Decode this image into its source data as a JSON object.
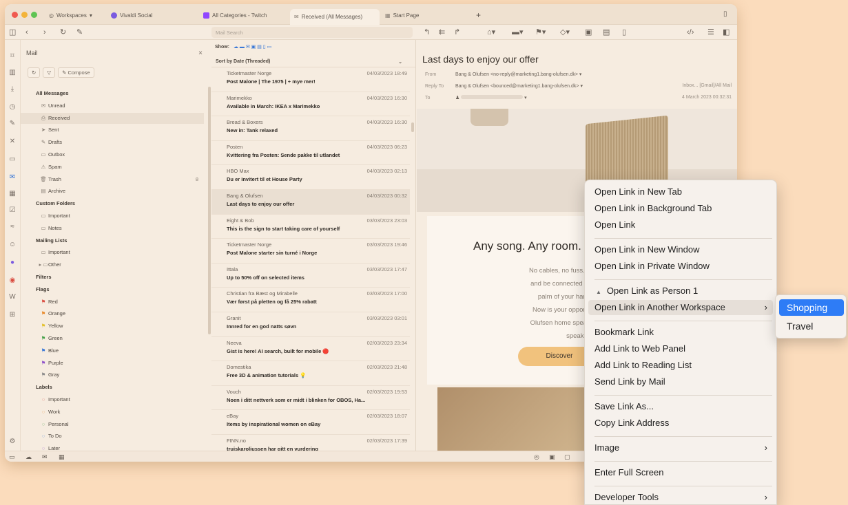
{
  "tabs": {
    "workspaces": "Workspaces",
    "items": [
      {
        "label": "Vivaldi Social",
        "color": "#7b5be0"
      },
      {
        "label": "All Categories - Twitch",
        "color": "#9146ff"
      },
      {
        "label": "Received (All Messages)",
        "color": "#8a8076"
      },
      {
        "label": "Start Page",
        "color": "#8a8076"
      }
    ],
    "new_tab": "+"
  },
  "search": {
    "placeholder": "Mail Search"
  },
  "mail": {
    "title": "Mail",
    "close": "×",
    "compose": "Compose",
    "folders": [
      {
        "label": "All Messages",
        "type": "head"
      },
      {
        "label": "Unread",
        "icon": "✉",
        "type": "item"
      },
      {
        "label": "Received",
        "icon": "⎙",
        "type": "item",
        "selected": true
      },
      {
        "label": "Sent",
        "icon": "➤",
        "type": "item"
      },
      {
        "label": "Drafts",
        "icon": "✎",
        "type": "item"
      },
      {
        "label": "Outbox",
        "icon": "▭",
        "type": "item"
      },
      {
        "label": "Spam",
        "icon": "⚠",
        "type": "item"
      },
      {
        "label": "Trash",
        "icon": "🗑",
        "type": "item",
        "count": "8"
      },
      {
        "label": "Archive",
        "icon": "▤",
        "type": "item"
      },
      {
        "label": "Custom Folders",
        "type": "head"
      },
      {
        "label": "Important",
        "icon": "▭",
        "type": "item"
      },
      {
        "label": "Notes",
        "icon": "▭",
        "type": "item"
      },
      {
        "label": "Mailing Lists",
        "type": "head"
      },
      {
        "label": "Important",
        "icon": "▭",
        "type": "item"
      },
      {
        "label": "Other",
        "icon": "▸ ▭",
        "type": "item"
      },
      {
        "label": "Filters",
        "type": "head"
      },
      {
        "label": "Flags",
        "type": "head"
      },
      {
        "label": "Red",
        "icon": "⚑",
        "color": "#d94b3f",
        "type": "item"
      },
      {
        "label": "Orange",
        "icon": "⚑",
        "color": "#e98a2b",
        "type": "item"
      },
      {
        "label": "Yellow",
        "icon": "⚑",
        "color": "#e3c02a",
        "type": "item"
      },
      {
        "label": "Green",
        "icon": "⚑",
        "color": "#45a049",
        "type": "item"
      },
      {
        "label": "Blue",
        "icon": "⚑",
        "color": "#3a78d6",
        "type": "item"
      },
      {
        "label": "Purple",
        "icon": "⚑",
        "color": "#8d4fc9",
        "type": "item"
      },
      {
        "label": "Gray",
        "icon": "⚑",
        "color": "#8a8a8a",
        "type": "item"
      },
      {
        "label": "Labels",
        "type": "head"
      },
      {
        "label": "Important",
        "icon": "◌",
        "color": "#d94b3f",
        "type": "item"
      },
      {
        "label": "Work",
        "icon": "◌",
        "color": "#e98a2b",
        "type": "item"
      },
      {
        "label": "Personal",
        "icon": "◌",
        "color": "#45a049",
        "type": "item"
      },
      {
        "label": "To Do",
        "icon": "◌",
        "color": "#3a78d6",
        "type": "item"
      },
      {
        "label": "Later",
        "icon": "◌",
        "color": "#8d4fc9",
        "type": "item"
      }
    ]
  },
  "list": {
    "show_label": "Show:",
    "sort_label": "Sort by Date (Threaded)",
    "messages": [
      {
        "from": "Ticketmaster Norge",
        "date": "04/03/2023 18:49",
        "subject": "Post Malone | The 1975 | + mye mer!"
      },
      {
        "from": "Marimekko",
        "date": "04/03/2023 16:30",
        "subject": "Available in March: IKEA x Marimekko"
      },
      {
        "from": "Bread & Boxers",
        "date": "04/03/2023 16:30",
        "subject": "New in: Tank relaxed"
      },
      {
        "from": "Posten",
        "date": "04/03/2023 06:23",
        "subject": "Kvittering fra Posten: Sende pakke til utlandet"
      },
      {
        "from": "HBO Max",
        "date": "04/03/2023 02:13",
        "subject": "Du er invitert til et House Party"
      },
      {
        "from": "Bang & Olufsen",
        "date": "04/03/2023 00:32",
        "subject": "Last days to enjoy our offer",
        "selected": true
      },
      {
        "from": "Eight & Bob",
        "date": "03/03/2023 23:03",
        "subject": "This is the sign to start taking care of yourself"
      },
      {
        "from": "Ticketmaster Norge",
        "date": "03/03/2023 19:46",
        "subject": "Post Malone starter sin turné i Norge"
      },
      {
        "from": "Ittala",
        "date": "03/03/2023 17:47",
        "subject": "Up to 50% off on selected items"
      },
      {
        "from": "Christian fra Bæst og Mirabelle",
        "date": "03/03/2023 17:00",
        "subject": "Vær først på pletten og få 25% rabatt"
      },
      {
        "from": "Granit",
        "date": "03/03/2023 03:01",
        "subject": "Innred for en god natts søvn"
      },
      {
        "from": "Neeva",
        "date": "02/03/2023 23:34",
        "subject": "Gist is here! AI search, built for mobile 🔴"
      },
      {
        "from": "Domestika",
        "date": "02/03/2023 21:48",
        "subject": "Free 3D & animation tutorials 💡"
      },
      {
        "from": "Vouch",
        "date": "02/03/2023 19:53",
        "subject": "Noen i ditt nettverk som er midt i blinken for OBOS, Ha..."
      },
      {
        "from": "eBay",
        "date": "02/03/2023 18:07",
        "subject": "Items by inspirational women on eBay"
      },
      {
        "from": "FINN.no",
        "date": "02/03/2023 17:39",
        "subject": "truiskaroliussen har gitt en vurdering"
      }
    ]
  },
  "reader": {
    "subject": "Last days to enjoy our offer",
    "from_label": "From",
    "from_value": "Bang & Olufsen <no-reply@marketing1.bang-olufsen.dk>",
    "replyto_label": "Reply To",
    "replyto_value": "Bang & Olufsen <bounced@marketing1.bang-olufsen.dk>",
    "to_label": "To",
    "folder": "Inbox... [Gmail]/All Mail",
    "timestamp": "4 March 2023 00:32:31",
    "promo_title": "Any song. Any room.",
    "promo_lines": [
      "No cables, no fuss. Connect speakers",
      "and be connected everywhere. Contr",
      "palm of your hand: play what yo",
      "Now is your opportunity to create or",
      "Olufsen home speaker system set up",
      "speakers on"
    ],
    "promo_button": "Discover"
  },
  "context_menu": {
    "items": [
      {
        "label": "Open Link in New Tab"
      },
      {
        "label": "Open Link in Background Tab"
      },
      {
        "label": "Open Link"
      },
      {
        "sep": true
      },
      {
        "label": "Open Link in New Window"
      },
      {
        "label": "Open Link in Private Window"
      },
      {
        "sep": true
      },
      {
        "label": "Open Link as Person 1",
        "icon": "▲"
      },
      {
        "label": "Open Link in Another Workspace",
        "arrow": "›",
        "highlighted": true
      },
      {
        "sep": true
      },
      {
        "label": "Bookmark Link"
      },
      {
        "label": "Add Link to Web Panel"
      },
      {
        "label": "Add Link to Reading List"
      },
      {
        "label": "Send Link by Mail"
      },
      {
        "sep": true
      },
      {
        "label": "Save Link As..."
      },
      {
        "label": "Copy Link Address"
      },
      {
        "sep": true
      },
      {
        "label": "Image",
        "arrow": "›"
      },
      {
        "sep": true
      },
      {
        "label": "Enter Full Screen"
      },
      {
        "sep": true
      },
      {
        "label": "Developer Tools",
        "arrow": "›"
      }
    ],
    "submenu": [
      {
        "label": "Shopping",
        "highlighted": true
      },
      {
        "label": "Travel"
      }
    ]
  }
}
